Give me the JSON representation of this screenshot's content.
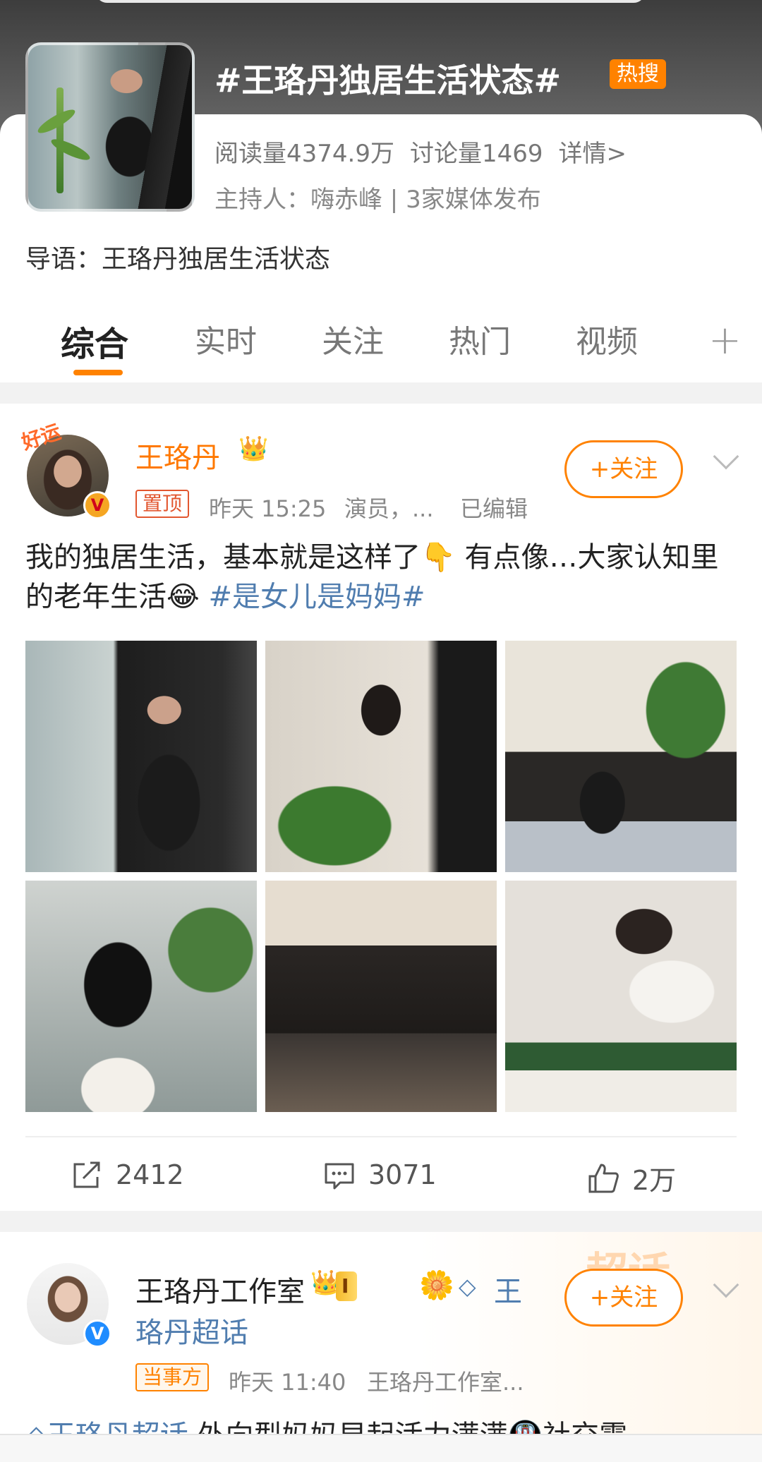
{
  "topic": {
    "title": "#王珞丹独居生活状态#",
    "hot_badge": "热搜",
    "reads": "阅读量4374.9万",
    "discussions": "讨论量1469",
    "details_link": "详情>",
    "host_line": "主持人：嗨赤峰 | 3家媒体发布",
    "intro": "导语：王珞丹独居生活状态"
  },
  "tabs": [
    "综合",
    "实时",
    "关注",
    "热门",
    "视频"
  ],
  "post1": {
    "avatar_sticker": "好运",
    "author": "王珞丹",
    "pinned": "置顶",
    "time": "昨天 15:25",
    "source": "演员，...",
    "edited": "已编辑",
    "follow": "+关注",
    "text": "我的独居生活，基本就是这样了👇 有点像…大家认知里的老年生活😂 ",
    "hashtag": "#是女儿是妈妈#",
    "reposts": "2412",
    "comments": "3071",
    "likes": "2万"
  },
  "post2": {
    "banner": "超话",
    "author": "王珞丹工作室",
    "level": "I",
    "super_topic_part1": "王",
    "super_topic_part2": "珞丹超话",
    "party_badge": "当事方",
    "time": "昨天 11:40",
    "source": "王珞丹工作室...",
    "follow": "+关注",
    "text_link": "王珞丹超话",
    "text": " 外向型妈妈早起活力满满🚇社交震"
  },
  "colors": {
    "accent": "#ff8200",
    "link": "#507daf",
    "author_orange": "#ff7800"
  },
  "icons": [
    "share-icon",
    "comment-icon",
    "like-icon",
    "chevron-down-icon",
    "plus-icon",
    "verified-icon",
    "crown-icon",
    "diamond-icon"
  ]
}
